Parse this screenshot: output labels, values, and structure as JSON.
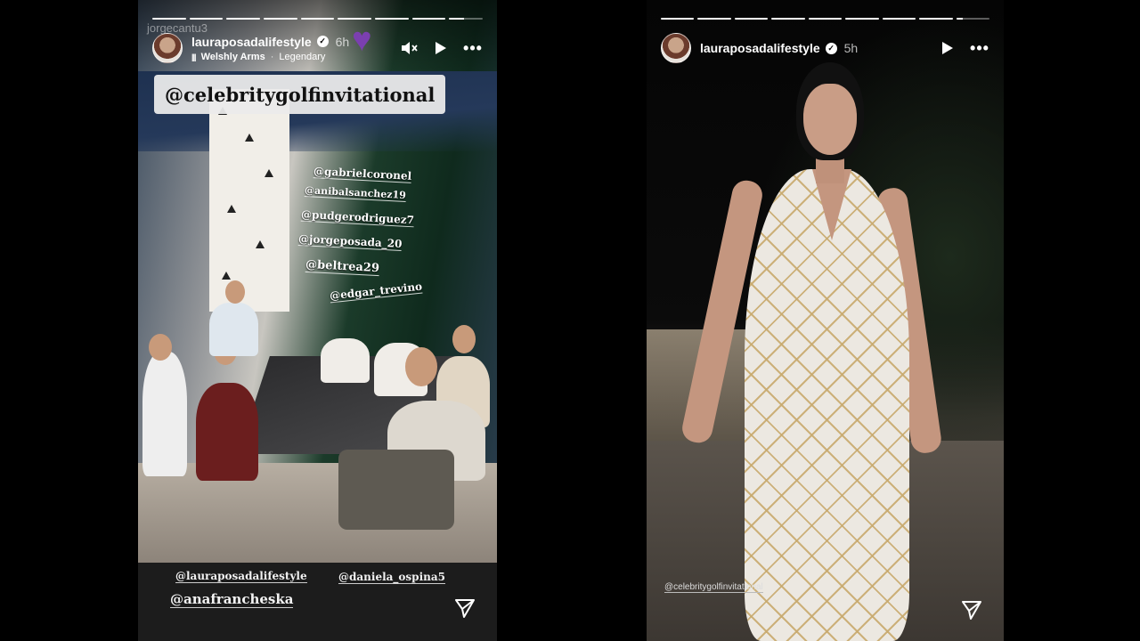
{
  "story1": {
    "prev_username": "jorgecantu3",
    "username": "lauraposadalifestyle",
    "time": "6h",
    "music": {
      "icon": "music-bars-icon",
      "artist": "Welshly Arms",
      "separator": "·",
      "song": "Legendary"
    },
    "progress": [
      1,
      1,
      1,
      1,
      1,
      1,
      1,
      1,
      0.45
    ],
    "sticker": "@celebritygolfinvitational",
    "mentions": [
      "@gabrielcoronel",
      "@anibalsanchez19",
      "@pudgerodriguez7",
      "@jorgeposada_20",
      "@beltrea29",
      "@edgar_trevino"
    ],
    "bottom_mentions": [
      "@lauraposadalifestyle",
      "@daniela_ospina5",
      "@anafrancheska"
    ]
  },
  "story2": {
    "username": "lauraposadalifestyle",
    "time": "5h",
    "progress": [
      1,
      1,
      1,
      1,
      1,
      1,
      1,
      1,
      0.2
    ],
    "tag": "@celebritygolfinvitational"
  },
  "colors": {
    "background": "#000000",
    "text": "#ffffff",
    "progress_track": "rgba(255,255,255,0.35)"
  }
}
